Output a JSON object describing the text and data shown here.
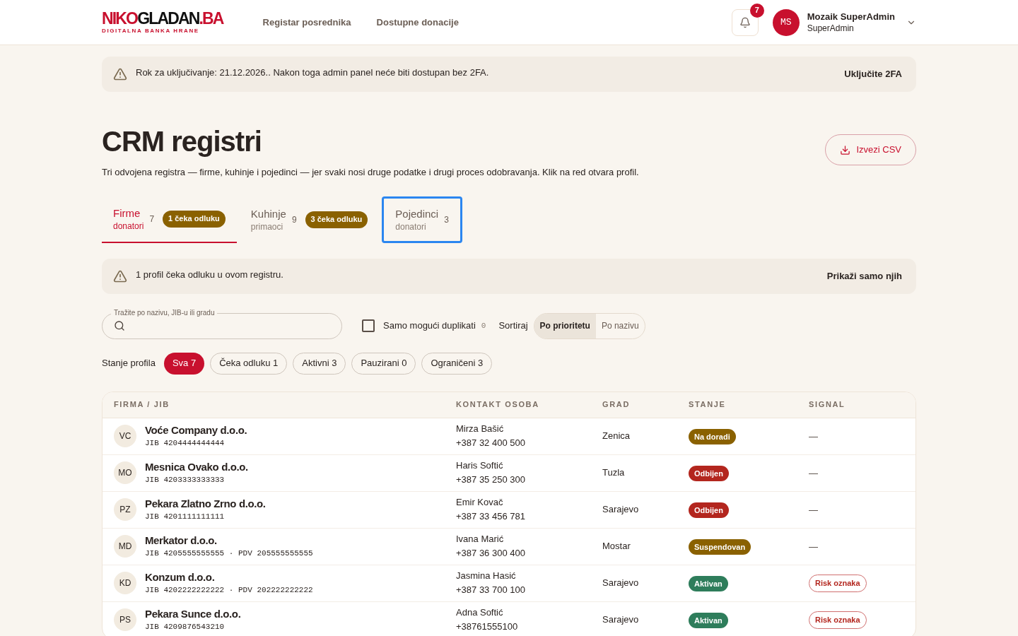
{
  "header": {
    "logo": {
      "parts": [
        {
          "text": "NIKO",
          "color": "#c8102e"
        },
        {
          "text": "GLADAN",
          "color": "#111111"
        },
        {
          "text": ".BA",
          "color": "#c8102e"
        }
      ],
      "tagline": "DIGITALNA BANKA HRANE"
    },
    "nav": [
      "Registar posrednika",
      "Dostupne donacije"
    ],
    "notifications": {
      "count": "7"
    },
    "user": {
      "initials": "MS",
      "name": "Mozaik SuperAdmin",
      "role": "SuperAdmin"
    }
  },
  "banner": {
    "text": "Rok za uključivanje: 21.12.2026.. Nakon toga admin panel neće biti dostupan bez 2FA.",
    "action": "Uključite 2FA"
  },
  "page": {
    "title": "CRM registri",
    "subtitle": "Tri odvojena registra — firme, kuhinje i pojedinci — jer svaki nosi druge podatke i drugi proces odobravanja. Klik na red otvara profil.",
    "export": "Izvezi CSV"
  },
  "tabs": [
    {
      "label": "Firme",
      "sub": "donatori",
      "count": "7",
      "badge": "1 čeka odluku",
      "selected": true,
      "focused": false
    },
    {
      "label": "Kuhinje",
      "sub": "primaoci",
      "count": "9",
      "badge": "3 čeka odluku",
      "selected": false,
      "focused": false
    },
    {
      "label": "Pojedinci",
      "sub": "donatori",
      "count": "3",
      "selected": false,
      "focused": true
    }
  ],
  "notice": {
    "text": "1 profil čeka odluku u ovom registru.",
    "action": "Prikaži samo njih"
  },
  "search": {
    "label": "Tražite po nazivu, JIB-u ili gradu"
  },
  "duplicates": {
    "label": "Samo mogući duplikati",
    "count": "0",
    "checked": false
  },
  "sort": {
    "label": "Sortiraj",
    "options": [
      {
        "label": "Po prioritetu",
        "selected": true
      },
      {
        "label": "Po nazivu",
        "selected": false
      }
    ]
  },
  "filters": {
    "label": "Stanje profila",
    "chips": [
      {
        "label": "Sva 7",
        "selected": true
      },
      {
        "label": "Čeka odluku 1",
        "selected": false
      },
      {
        "label": "Aktivni 3",
        "selected": false
      },
      {
        "label": "Pauzirani 0",
        "selected": false
      },
      {
        "label": "Ograničeni 3",
        "selected": false
      }
    ]
  },
  "table": {
    "columns": [
      "FIRMA / JIB",
      "KONTAKT OSOBA",
      "GRAD",
      "STANJE",
      "SIGNAL"
    ],
    "rows": [
      {
        "initials": "VC",
        "name": "Voće Company d.o.o.",
        "ids": "JIB 4204444444444",
        "contact": "Mirza Bašić",
        "phone": "+387 32 400 500",
        "city": "Zenica",
        "status": {
          "label": "Na doradi",
          "color": "#8a6100"
        },
        "signal": {
          "kind": "none",
          "text": "—"
        }
      },
      {
        "initials": "MO",
        "name": "Mesnica Ovako d.o.o.",
        "ids": "JIB 4203333333333",
        "contact": "Haris Softić",
        "phone": "+387 35 250 300",
        "city": "Tuzla",
        "status": {
          "label": "Odbijen",
          "color": "#b3261e"
        },
        "signal": {
          "kind": "none",
          "text": "—"
        }
      },
      {
        "initials": "PZ",
        "name": "Pekara Zlatno Zrno d.o.o.",
        "ids": "JIB 4201111111111",
        "contact": "Emir Kovač",
        "phone": "+387 33 456 781",
        "city": "Sarajevo",
        "status": {
          "label": "Odbijen",
          "color": "#b3261e"
        },
        "signal": {
          "kind": "none",
          "text": "—"
        }
      },
      {
        "initials": "MD",
        "name": "Merkator d.o.o.",
        "ids": "JIB 4205555555555 · PDV 205555555555",
        "contact": "Ivana Marić",
        "phone": "+387 36 300 400",
        "city": "Mostar",
        "status": {
          "label": "Suspendovan",
          "color": "#8a6100"
        },
        "signal": {
          "kind": "none",
          "text": "—"
        }
      },
      {
        "initials": "KD",
        "name": "Konzum d.o.o.",
        "ids": "JIB 4202222222222 · PDV 202222222222",
        "contact": "Jasmina Hasić",
        "phone": "+387 33 700 100",
        "city": "Sarajevo",
        "status": {
          "label": "Aktivan",
          "color": "#2e7d5b"
        },
        "signal": {
          "kind": "risk",
          "text": "Risk oznaka"
        }
      },
      {
        "initials": "PS",
        "name": "Pekara Sunce d.o.o.",
        "ids": "JIB 4209876543210",
        "contact": "Adna Softić",
        "phone": "+38761555100",
        "city": "Sarajevo",
        "status": {
          "label": "Aktivan",
          "color": "#2e7d5b"
        },
        "signal": {
          "kind": "risk",
          "text": "Risk oznaka"
        }
      }
    ]
  }
}
